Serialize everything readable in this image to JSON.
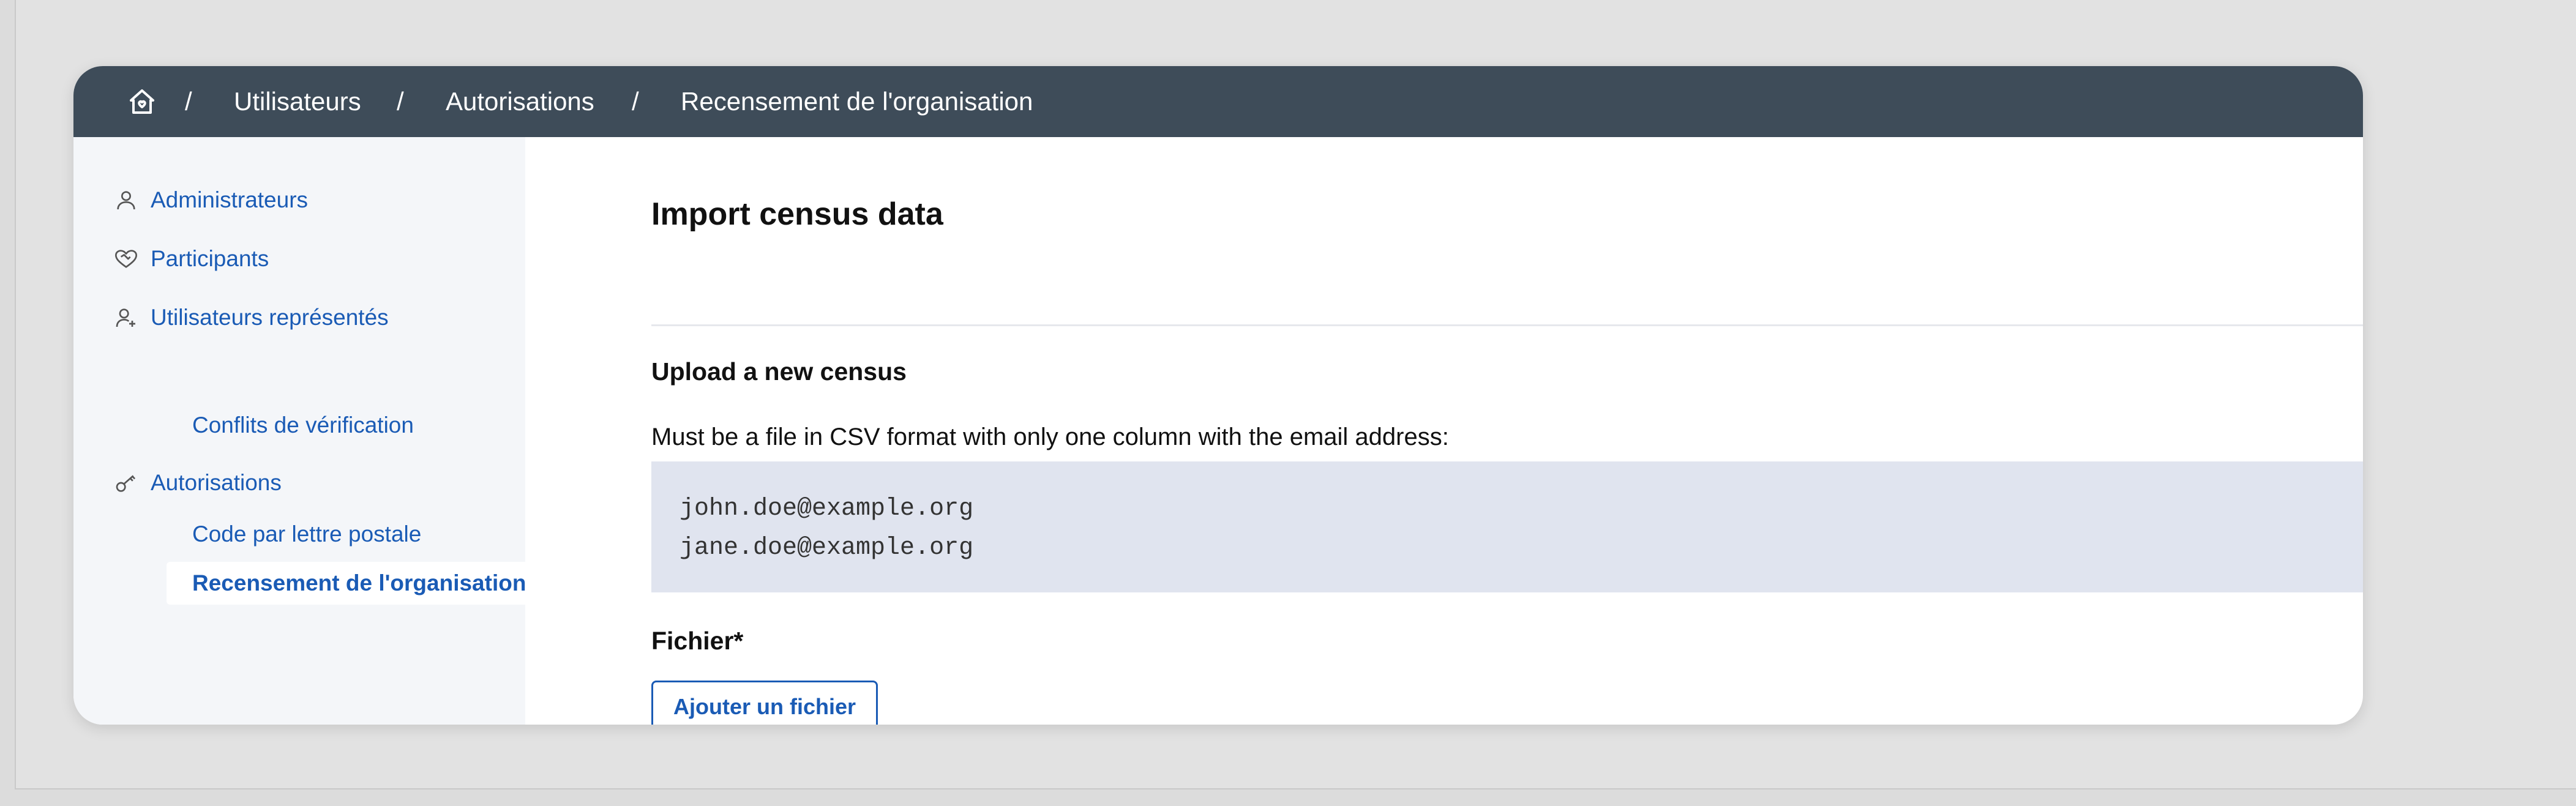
{
  "breadcrumb": {
    "separator": "/",
    "items": [
      "Utilisateurs",
      "Autorisations",
      "Recensement de l'organisation"
    ]
  },
  "sidebar": {
    "items": [
      {
        "label": "Administrateurs",
        "icon": "user-icon"
      },
      {
        "label": "Participants",
        "icon": "heart-handshake-icon"
      },
      {
        "label": "Utilisateurs représentés",
        "icon": "user-add-icon"
      },
      {
        "label": "Autorisations",
        "icon": "key-icon"
      }
    ],
    "subitems": {
      "verification_conflicts": "Conflits de vérification",
      "postal_code": "Code par lettre postale",
      "census": "Recensement de l'organisation"
    }
  },
  "main": {
    "title": "Import census data",
    "subtitle": "Upload a new census",
    "description": "Must be a file in CSV format with only one column with the email address:",
    "code_lines": [
      "john.doe@example.org",
      "jane.doe@example.org"
    ],
    "file_label": "Fichier*",
    "add_file_button": "Ajouter un fichier"
  },
  "colors": {
    "topbar": "#3e4c59",
    "link": "#1a5bb5",
    "code_bg": "#e0e4ef",
    "sidebar_bg": "#f4f6f9"
  }
}
